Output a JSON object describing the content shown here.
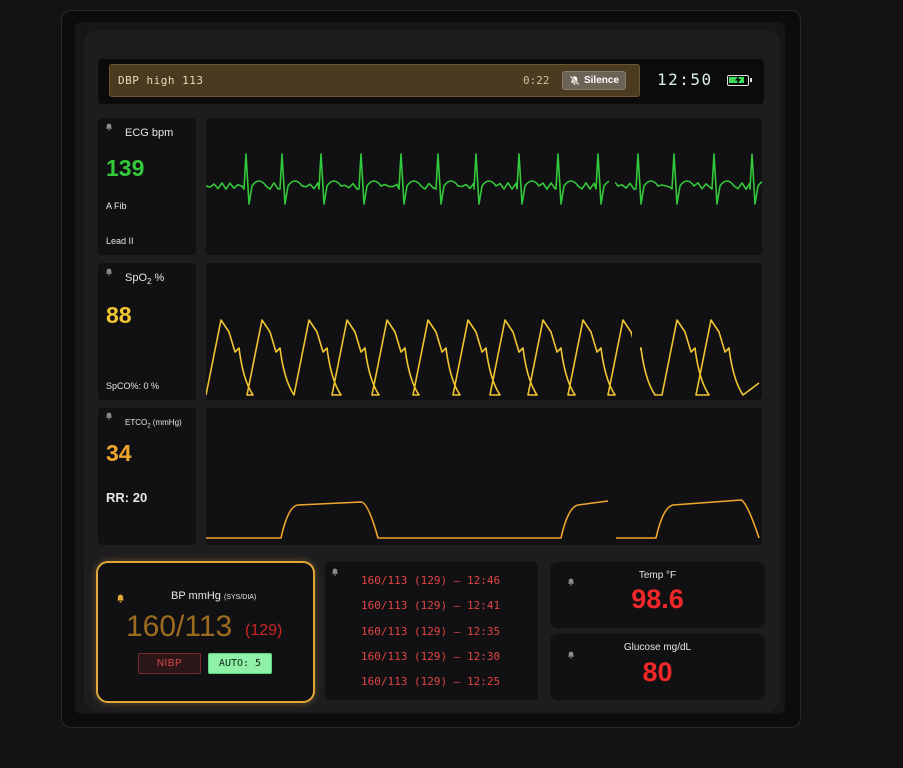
{
  "alarm": {
    "message": "DBP high 113",
    "elapsed": "0:22",
    "silence_label": "Silence"
  },
  "status": {
    "clock": "12:50"
  },
  "ecg": {
    "label": "ECG bpm",
    "value": "139",
    "rhythm": "A Fib",
    "lead": "Lead II",
    "color": "#34c93a"
  },
  "spo2": {
    "label_main": "SpO",
    "label_sub": "2",
    "label_unit": " %",
    "value": "88",
    "spco": "SpCO%: 0 %",
    "color": "#f0c531"
  },
  "etco2": {
    "label_main": "ETCO",
    "label_sub": "2",
    "label_unit": " (mmHg)",
    "value": "34",
    "rr_label": "RR:",
    "rr_value": "20",
    "color": "#f0a52b"
  },
  "bp": {
    "label": "BP mmHg",
    "label_sub": "(SYS/DIA)",
    "value": "160/113",
    "mean": "(129)",
    "nibp_label": "NIBP",
    "auto_label": "AUTO: 5",
    "value_color": "#9c6b1f",
    "mean_color": "#cc2626"
  },
  "bp_history": [
    "160/113 (129) — 12:46",
    "160/113 (129) — 12:41",
    "160/113 (129) — 12:35",
    "160/113 (129) — 12:30",
    "160/113 (129) — 12:25"
  ],
  "temp": {
    "label": "Temp °F",
    "value": "98.6",
    "color": "#f0282a"
  },
  "glucose": {
    "label": "Glucose mg/dL",
    "value": "80",
    "color": "#f0282a"
  },
  "icons": [
    "bell-icon",
    "bell-slash-icon",
    "battery-icon"
  ]
}
